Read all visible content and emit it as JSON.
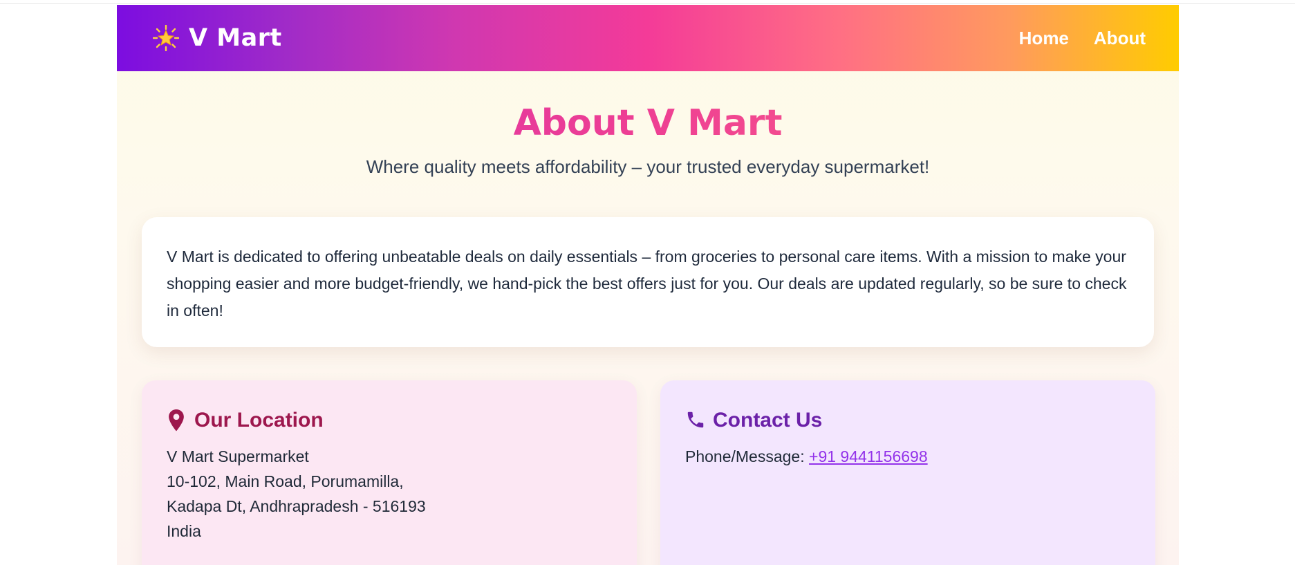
{
  "brand": {
    "icon": "glowing-star-icon",
    "name": "V Mart"
  },
  "nav": {
    "items": [
      {
        "label": "Home"
      },
      {
        "label": "About"
      }
    ]
  },
  "hero": {
    "title": "About V Mart",
    "subtitle": "Where quality meets affordability – your trusted everyday supermarket!"
  },
  "about": {
    "text": "V Mart is dedicated to offering unbeatable deals on daily essentials – from groceries to personal care items. With a mission to make your shopping easier and more budget-friendly, we hand-pick the best offers just for you. Our deals are updated regularly, so be sure to check in often!"
  },
  "location": {
    "icon": "map-pin-icon",
    "heading": "Our Location",
    "lines": [
      "V Mart Supermarket",
      "10-102, Main Road, Porumamilla,",
      "Kadapa Dt, Andhrapradesh - 516193",
      "India"
    ]
  },
  "contact": {
    "icon": "phone-icon",
    "heading": "Contact Us",
    "label": "Phone/Message: ",
    "phone": "+91 9441156698"
  },
  "colors": {
    "nav_gradient": [
      "#7c0de0",
      "#f43b98",
      "#ffcc00"
    ],
    "title_gradient": [
      "#d32fb0",
      "#ff6d84"
    ],
    "location_card_bg": "#fce7f3",
    "contact_card_bg": "#f3e6fe",
    "location_accent": "#9d174d",
    "contact_accent": "#6b21a8",
    "link": "#9333ea"
  }
}
